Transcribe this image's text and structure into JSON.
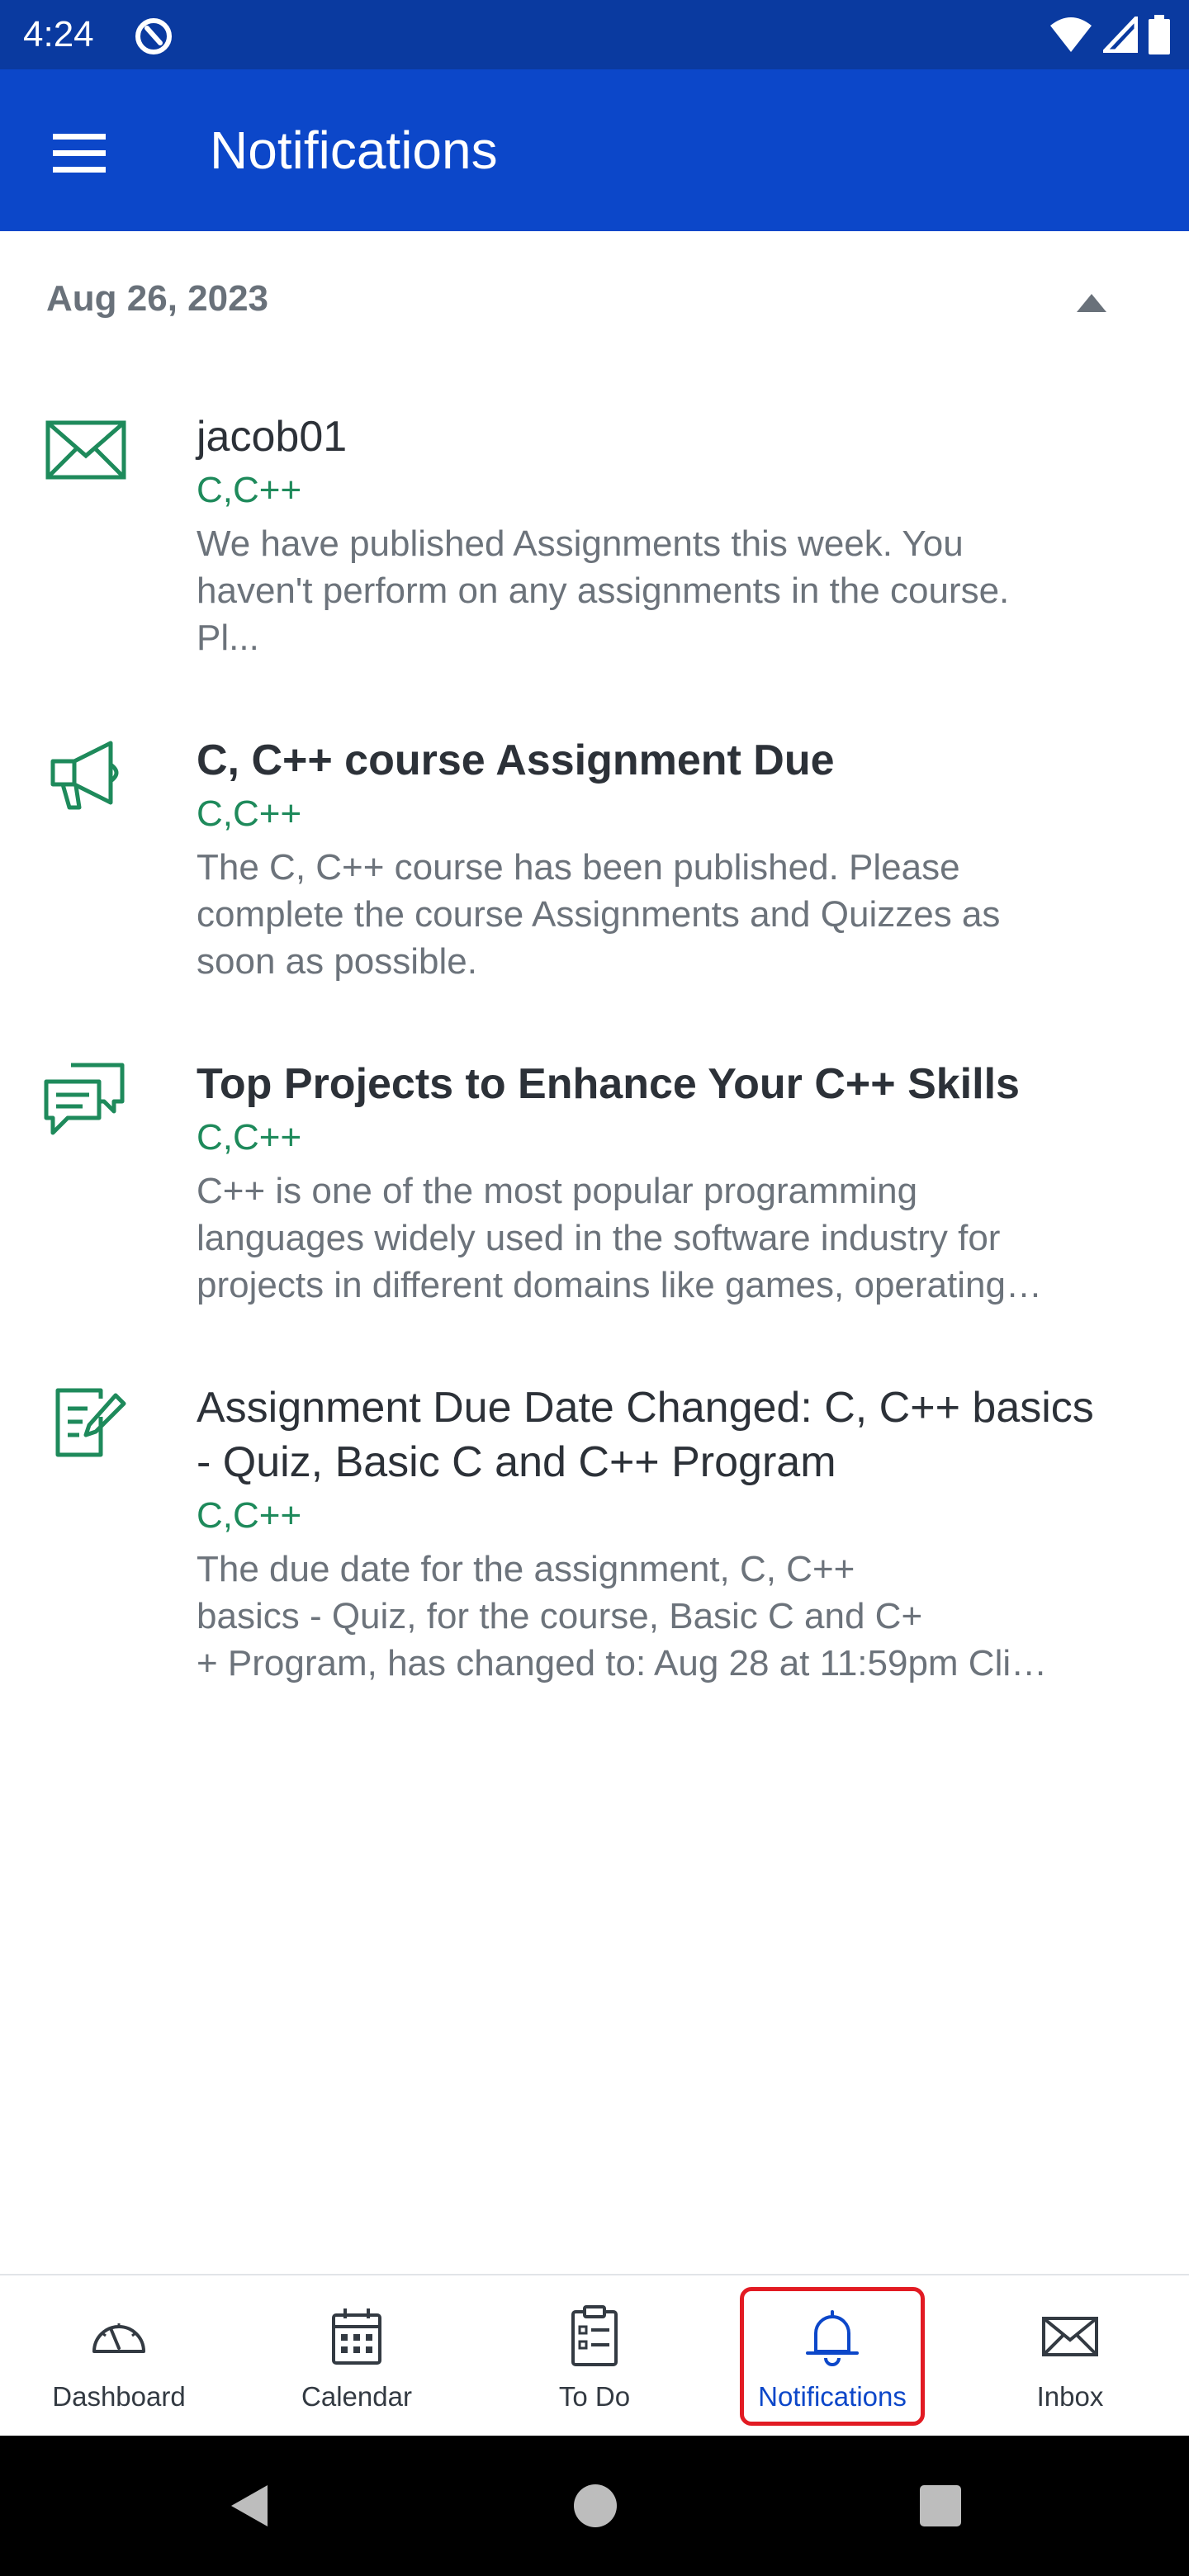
{
  "status_bar": {
    "time": "4:24"
  },
  "app_bar": {
    "title": "Notifications"
  },
  "section": {
    "date": "Aug 26, 2023"
  },
  "notifications": [
    {
      "icon": "envelope-icon",
      "title": "jacob01",
      "course": "C,C++",
      "description_lines": [
        "We have published Assignments this week. You",
        "haven't perform on any assignments in the course.",
        "Pl..."
      ]
    },
    {
      "icon": "megaphone-icon",
      "title": "C, C++ course Assignment Due",
      "course": "C,C++",
      "description_lines": [
        "The C, C++ course has been published. Please",
        "complete the course Assignments and Quizzes as",
        "soon as possible."
      ]
    },
    {
      "icon": "chat-bubbles-icon",
      "title": "Top Projects to Enhance Your C++ Skills",
      "course": "C,C++",
      "description_lines": [
        "C++ is one of the most popular programming",
        "languages widely used in the software industry for",
        "projects in different domains like games, operating…"
      ]
    },
    {
      "icon": "assignment-edit-icon",
      "title_lines": [
        "Assignment Due Date Changed: C, C++ basics",
        "- Quiz, Basic C and C++ Program"
      ],
      "course": "C,C++",
      "description_lines": [
        "The due date for the assignment, C, C++",
        "basics - Quiz, for the course, Basic C and C+",
        "+ Program, has changed to: Aug 28 at 11:59pm Cli…"
      ]
    }
  ],
  "bottom_nav": {
    "items": [
      {
        "label": "Dashboard",
        "icon": "dashboard-gauge-icon"
      },
      {
        "label": "Calendar",
        "icon": "calendar-icon"
      },
      {
        "label": "To Do",
        "icon": "todo-clipboard-icon"
      },
      {
        "label": "Notifications",
        "icon": "bell-icon",
        "active": true
      },
      {
        "label": "Inbox",
        "icon": "inbox-envelope-icon"
      }
    ]
  },
  "colors": {
    "status_bar": "#0a3aa0",
    "app_bar": "#0c47c9",
    "accent_green": "#1e8a5b",
    "active_highlight": "#e21b23"
  }
}
